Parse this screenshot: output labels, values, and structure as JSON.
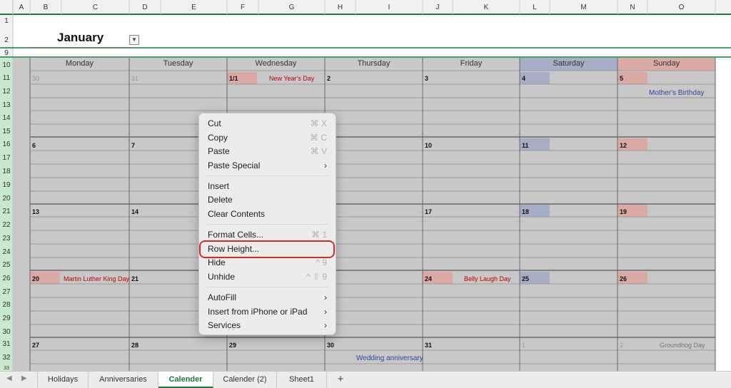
{
  "columns": [
    "A",
    "B",
    "C",
    "D",
    "E",
    "F",
    "G",
    "H",
    "I",
    "J",
    "K",
    "L",
    "M",
    "N",
    "O"
  ],
  "rows": [
    "1",
    "2",
    "9",
    "10",
    "11",
    "12",
    "13",
    "14",
    "15",
    "16",
    "17",
    "18",
    "19",
    "20",
    "21",
    "22",
    "23",
    "24",
    "25",
    "26",
    "27",
    "28",
    "29",
    "30",
    "31",
    "32",
    "33"
  ],
  "month": {
    "title": "January",
    "dropdown_icon": "chevron-down-icon"
  },
  "days": [
    "Monday",
    "Tuesday",
    "Wednesday",
    "Thursday",
    "Friday",
    "Saturday",
    "Sunday"
  ],
  "weeks": [
    [
      "30",
      "31",
      "1/1",
      "2",
      "3",
      "4",
      "5"
    ],
    [
      "6",
      "7",
      "",
      "",
      "10",
      "11",
      "12"
    ],
    [
      "13",
      "14",
      "",
      "",
      "17",
      "18",
      "19"
    ],
    [
      "20",
      "21",
      "",
      "",
      "24",
      "25",
      "26"
    ],
    [
      "27",
      "28",
      "29",
      "30",
      "31",
      "1",
      "2"
    ]
  ],
  "events": {
    "new_years": "New Year's Day",
    "mothers_birthday": "Mother's Birthday",
    "mlk": "Martin Luther King Day",
    "belly_laugh": "Belly Laugh Day",
    "wedding": "Wedding anniversary",
    "groundhog": "Groundhog Day"
  },
  "context_menu": {
    "cut": "Cut",
    "cut_sc": "⌘ X",
    "copy": "Copy",
    "copy_sc": "⌘ C",
    "paste": "Paste",
    "paste_sc": "⌘ V",
    "paste_special": "Paste Special",
    "insert": "Insert",
    "delete": "Delete",
    "clear_contents": "Clear Contents",
    "format_cells": "Format Cells...",
    "format_cells_sc": "⌘ 1",
    "row_height": "Row Height...",
    "hide": "Hide",
    "hide_sc": "^ 9",
    "unhide": "Unhide",
    "unhide_sc": "^ ⇧ 9",
    "autofill": "AutoFill",
    "insert_iphone": "Insert from iPhone or iPad",
    "services": "Services",
    "submenu_arrow": "›"
  },
  "sheet_tabs": [
    "Holidays",
    "Anniversaries",
    "Calender",
    "Calender (2)",
    "Sheet1"
  ],
  "active_tab": "Calender",
  "add_tab": "+",
  "colors": {
    "cell_grey": "#c8c8c8",
    "saturday": "#a5aec6",
    "sunday": "#dcaaa5",
    "accent": "#1b7a3a",
    "highlight": "#d42a2a"
  }
}
